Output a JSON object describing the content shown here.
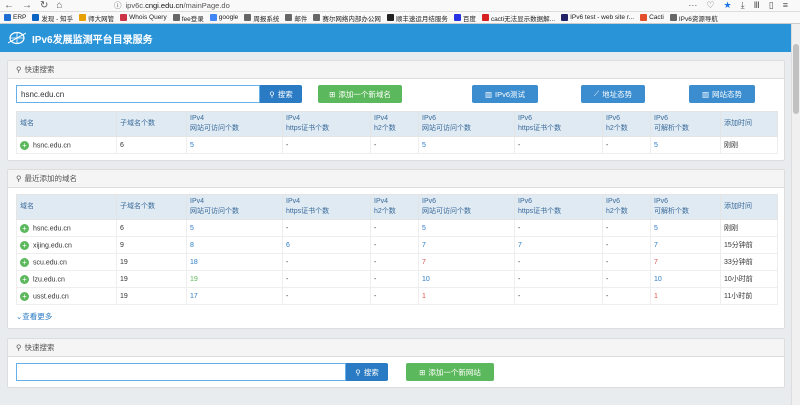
{
  "browser": {
    "url_prefix": "ipv6c.",
    "url_host": "cngi.edu.cn",
    "url_path": "/mainPage.do",
    "bookmarks": [
      {
        "label": "ERP",
        "color": "#1e6fd1"
      },
      {
        "label": "发现 - 知乎",
        "color": "#0a66c2"
      },
      {
        "label": "师大网管",
        "color": "#e8a000"
      },
      {
        "label": "Whois Query",
        "color": "#cc3344"
      },
      {
        "label": "fee登录",
        "color": "#666666"
      },
      {
        "label": "google",
        "color": "#4285f4"
      },
      {
        "label": "周报系统",
        "color": "#666666"
      },
      {
        "label": "邮件",
        "color": "#666666"
      },
      {
        "label": "赛尔网络内部办公网",
        "color": "#666666"
      },
      {
        "label": "顺丰速运月结服务",
        "color": "#222222"
      },
      {
        "label": "百度",
        "color": "#2932e1"
      },
      {
        "label": "cacti无法显示数据解...",
        "color": "#d72020"
      },
      {
        "label": "IPv6 test - web site r...",
        "color": "#222266"
      },
      {
        "label": "Cacti",
        "color": "#e34d2c"
      },
      {
        "label": "IPv6资源导航",
        "color": "#666666"
      }
    ]
  },
  "app": {
    "title": "IPv6发展监测平台目录服务"
  },
  "quick_search": {
    "header": "快速搜索",
    "input_value": "hsnc.edu.cn",
    "search_label": "搜索",
    "add_domain_label": "添加一个新域名",
    "ipv6_test_label": "IPv6测试",
    "domain_trend_label": "地址态势",
    "site_trend_label": "网站态势"
  },
  "columns": [
    {
      "l1": "域名",
      "l2": ""
    },
    {
      "l1": "子域名个数",
      "l2": ""
    },
    {
      "l1": "IPv4",
      "l2": "网站可访问个数"
    },
    {
      "l1": "IPv4",
      "l2": "https证书个数"
    },
    {
      "l1": "IPv4",
      "l2": "h2个数"
    },
    {
      "l1": "IPv6",
      "l2": "网站可访问个数"
    },
    {
      "l1": "IPv6",
      "l2": "https证书个数"
    },
    {
      "l1": "IPv6",
      "l2": "h2个数"
    },
    {
      "l1": "IPv6",
      "l2": "可解析个数"
    },
    {
      "l1": "添加时间",
      "l2": ""
    }
  ],
  "search_result": [
    {
      "domain": "hsnc.edu.cn",
      "sub": "6",
      "v4web": "5",
      "v4https": "-",
      "v4h2": "-",
      "v6web": "5",
      "v6https": "-",
      "v6h2": "-",
      "v6dns": "5",
      "time": "刚刚"
    }
  ],
  "recent": {
    "header": "最近添加的域名",
    "more_label": "查看更多",
    "rows": [
      {
        "domain": "hsnc.edu.cn",
        "sub": "6",
        "v4web": "5",
        "v4https": "-",
        "v4h2": "-",
        "v6web": "5",
        "v6https": "-",
        "v6h2": "-",
        "v6dns": "5",
        "time": "刚刚"
      },
      {
        "domain": "xijing.edu.cn",
        "sub": "9",
        "v4web": "8",
        "v4https": "6",
        "v4h2": "-",
        "v6web": "7",
        "v6https": "7",
        "v6h2": "-",
        "v6dns": "7",
        "time": "15分钟前"
      },
      {
        "domain": "scu.edu.cn",
        "sub": "19",
        "v4web": "18",
        "v4https": "-",
        "v4h2": "-",
        "v6web": "7",
        "v6https": "-",
        "v6h2": "-",
        "v6dns": "7",
        "time": "33分钟前"
      },
      {
        "domain": "lzu.edu.cn",
        "sub": "19",
        "v4web": "19",
        "v4https": "-",
        "v4h2": "-",
        "v6web": "10",
        "v6https": "-",
        "v6h2": "-",
        "v6dns": "10",
        "time": "10小时前"
      },
      {
        "domain": "usst.edu.cn",
        "sub": "19",
        "v4web": "17",
        "v4https": "-",
        "v4h2": "-",
        "v6web": "1",
        "v6https": "-",
        "v6h2": "-",
        "v6dns": "1",
        "time": "11小时前"
      }
    ]
  },
  "site_search": {
    "header": "快速搜索",
    "input_value": "",
    "search_label": "搜索",
    "add_site_label": "添加一个新网站"
  },
  "colors": {
    "accent": "#2a94d8",
    "link": "#2a7bc4",
    "green": "#5cb85c",
    "red": "#d9534f"
  }
}
